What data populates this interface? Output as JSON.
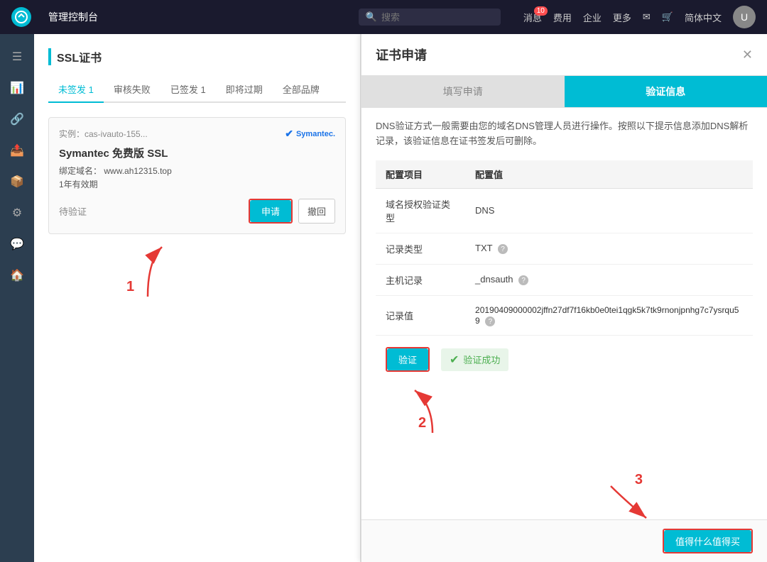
{
  "topnav": {
    "logo_text": "管理控制台",
    "search_placeholder": "搜索",
    "search_icon": "🔍",
    "nav_items": [
      {
        "label": "消息",
        "badge": "10"
      },
      {
        "label": "费用"
      },
      {
        "label": "企业"
      },
      {
        "label": "更多"
      },
      {
        "label": "✉"
      },
      {
        "label": "🛒"
      },
      {
        "label": "简体中文"
      }
    ],
    "avatar_text": "U"
  },
  "sidebar": {
    "icons": [
      "☰",
      "📊",
      "🔗",
      "📤",
      "📦",
      "🔧",
      "💬",
      "🏠"
    ]
  },
  "left_panel": {
    "title": "SSL证书",
    "tabs": [
      {
        "label": "未签发 1",
        "active": true
      },
      {
        "label": "审核失败"
      },
      {
        "label": "已签发 1"
      },
      {
        "label": "即将过期"
      },
      {
        "label": "全部品牌"
      }
    ],
    "cert_card": {
      "instance": "实例：cas-ivauto-155...",
      "brand": "Symantec.",
      "name": "Symantec 免费版 SSL",
      "domain_label": "绑定域名：",
      "domain": "www.ah12315.top",
      "validity": "1年有效期",
      "status": "待验证",
      "apply_btn": "申请",
      "revoke_btn": "撤回"
    },
    "annotation_number": "1"
  },
  "modal": {
    "title": "证书申请",
    "close_btn": "✕",
    "steps": [
      {
        "label": "填写申请",
        "active": false
      },
      {
        "label": "验证信息",
        "active": true
      }
    ],
    "desc": "DNS验证方式一般需要由您的域名DNS管理人员进行操作。按照以下提示信息添加DNS解析记录，该验证信息在证书签发后可删除。",
    "table": {
      "col1": "配置项目",
      "col2": "配置值",
      "rows": [
        {
          "item": "域名授权验证类型",
          "value": "DNS"
        },
        {
          "item": "记录类型",
          "value": "TXT",
          "has_help": true
        },
        {
          "item": "主机记录",
          "value": "_dnsauth",
          "has_help": true
        },
        {
          "item": "记录值",
          "value": "20190409000002jffn27df7f16kb0e0tei1qgk5k7tk9rnonjpnhg7c7ysrqu59",
          "has_help": true
        }
      ]
    },
    "verify_btn": "验证",
    "success_text": "验证成功",
    "footer_btns": [
      {
        "label": "值得什么值得买",
        "type": "primary"
      }
    ],
    "annotation_2": "2",
    "annotation_3": "3"
  }
}
